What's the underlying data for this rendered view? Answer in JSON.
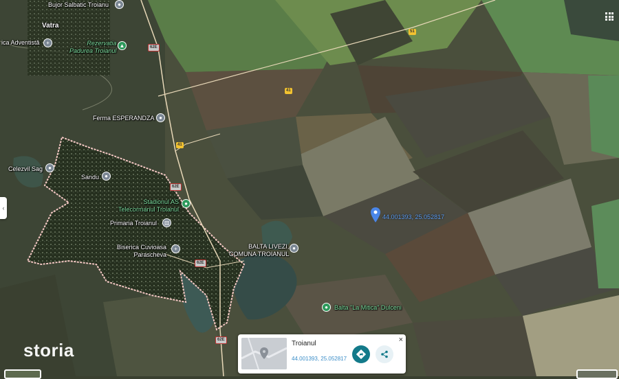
{
  "map": {
    "labels": {
      "bujor": "Bujor Salbatic Troianu",
      "vatra": "Vatra",
      "adventista": "ica Adventistă",
      "rezervatia": "Rezervatia\nPadurea Troianul",
      "ferma": "Ferma ESPERANDZA",
      "celezvil": "Celezvil Sag",
      "sandu": "Sandu",
      "stadionul": "Stadionul AS\nTelecormanul Troianul",
      "primaria": "Primaria Troianul",
      "biserica": "Biserica Cuvioasa\nParascheva",
      "balta_livezi": "BALTA LIVEZI,\nCOMUNA TROIANUL",
      "balta_mitica": "Balta \"La Mitica\" Dulceni"
    },
    "road_shields": {
      "s1": "51",
      "s2": "41",
      "s3": "41",
      "s4": "62E",
      "s5": "62E",
      "s6": "62E",
      "s7": "62E"
    },
    "marker_coords": "44.001393, 25.052817",
    "icons": {
      "poi": "place-pin-icon",
      "park": "tree-pin-icon",
      "religion": "cross-pin-icon",
      "landmark": "building-pin-icon",
      "sport": "sport-pin-icon",
      "marker": "location-marker-icon"
    }
  },
  "watermark": "storia",
  "place_card": {
    "title": "Troianul",
    "coords": "44.001393, 25.052817",
    "close": "×"
  },
  "colors": {
    "accent": "#137a8a",
    "marker": "#4a86e8",
    "boundary": "#f4c8c4"
  }
}
